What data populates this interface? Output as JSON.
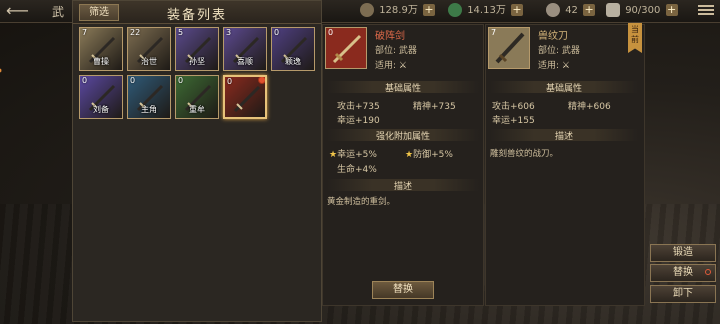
{
  "topbar": {
    "back": "⟵",
    "title_char": "武",
    "resources": [
      {
        "value": "128.9万",
        "color": "#8a7a5c"
      },
      {
        "value": "14.13万",
        "color": "#3d7a48"
      },
      {
        "value": "42",
        "color": "#9a8f80"
      },
      {
        "value": "90/300",
        "color": "#b8b0a0"
      }
    ],
    "plus": "+"
  },
  "list": {
    "filter_label": "筛选",
    "title": "装备列表",
    "items": [
      {
        "count": "7",
        "name": "曹操",
        "bg": "#8a7a58"
      },
      {
        "count": "22",
        "name": "治世",
        "bg": "#7c6c50"
      },
      {
        "count": "5",
        "name": "孙坚",
        "bg": "#5a4a8c"
      },
      {
        "count": "3",
        "name": "喜顺",
        "bg": "#5c4a90"
      },
      {
        "count": "0",
        "name": "颖逸",
        "bg": "#4f4082"
      },
      {
        "count": "0",
        "name": "刘备",
        "bg": "#5a48a0"
      },
      {
        "count": "0",
        "name": "主角",
        "bg": "#2f5a78"
      },
      {
        "count": "0",
        "name": "重牟",
        "bg": "#3d6a34"
      },
      {
        "count": "0",
        "name": "",
        "bg": "#8a2a1e"
      }
    ]
  },
  "detail_left": {
    "count": "0",
    "name": "破阵剑",
    "name_color": "#e06a4a",
    "slot": "部位: 武器",
    "use_label": "适用:",
    "base_title": "基础属性",
    "stats": [
      "攻击+735",
      "精神+735",
      "幸运+190"
    ],
    "bonus_title": "强化附加属性",
    "bonus": [
      "幸运+5%",
      "防御+5%",
      "生命+4%"
    ],
    "desc_title": "描述",
    "desc": "黄金制造的重剑。",
    "swap_label": "替换"
  },
  "detail_right": {
    "count": "7",
    "name": "兽纹刀",
    "name_color": "#d4b47a",
    "slot": "部位: 武器",
    "use_label": "适用:",
    "equipped_tag": "当前",
    "base_title": "基础属性",
    "stats": [
      "攻击+606",
      "精神+606",
      "幸运+155"
    ],
    "desc_title": "描述",
    "desc": "雕刻兽纹的战刀。"
  },
  "actions": {
    "forge": "锻造",
    "swap": "替换",
    "unequip": "卸下"
  }
}
